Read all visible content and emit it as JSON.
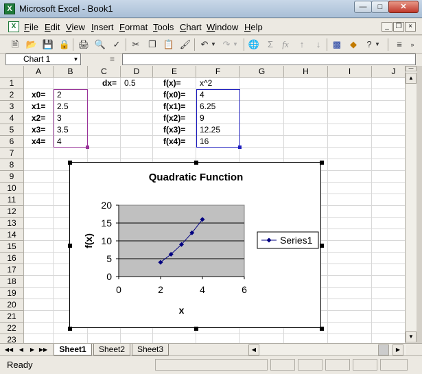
{
  "window": {
    "title": "Microsoft Excel - Book1",
    "app_icon": "X"
  },
  "menu": {
    "doc_icon": "X",
    "items": [
      {
        "label": "File",
        "accel": "F",
        "rest": "ile"
      },
      {
        "label": "Edit",
        "accel": "E",
        "rest": "dit"
      },
      {
        "label": "View",
        "accel": "V",
        "rest": "iew"
      },
      {
        "label": "Insert",
        "accel": "I",
        "rest": "nsert"
      },
      {
        "label": "Format",
        "accel": "F",
        "rest": "ormat",
        "pre": ""
      },
      {
        "label": "Tools",
        "accel": "T",
        "rest": "ools"
      },
      {
        "label": "Chart",
        "accel": "C",
        "rest": "hart"
      },
      {
        "label": "Window",
        "accel": "W",
        "rest": "indow"
      },
      {
        "label": "Help",
        "accel": "H",
        "rest": "elp"
      }
    ]
  },
  "formula_bar": {
    "name_box": "Chart 1",
    "equals": "=",
    "formula": ""
  },
  "columns": [
    "A",
    "B",
    "C",
    "D",
    "E",
    "F",
    "G",
    "H",
    "I",
    "J"
  ],
  "rows": [
    "1",
    "2",
    "3",
    "4",
    "5",
    "6",
    "7",
    "8",
    "9",
    "10",
    "11",
    "12",
    "13",
    "14",
    "15",
    "16",
    "17",
    "18",
    "19",
    "20",
    "21",
    "22",
    "23"
  ],
  "cells": {
    "C1": "dx=",
    "D1": "0.5",
    "E1": "f(x)=",
    "F1": "x^2",
    "A2": "x0=",
    "B2": "2",
    "E2": "f(x0)=",
    "F2": "4",
    "A3": "x1=",
    "B3": "2.5",
    "E3": "f(x1)=",
    "F3": "6.25",
    "A4": "x2=",
    "B4": "3",
    "E4": "f(x2)=",
    "F4": "9",
    "A5": "x3=",
    "B5": "3.5",
    "E5": "f(x3)=",
    "F5": "12.25",
    "A6": "x4=",
    "B6": "4",
    "E6": "f(x4)=",
    "F6": "16"
  },
  "colors": {
    "x_range_border": "#993399",
    "y_range_border": "#1f1fbf",
    "series": "#000080",
    "plot_area": "#c0c0c0"
  },
  "chart_data": {
    "type": "scatter",
    "title": "Quadratic Function",
    "xlabel": "x",
    "ylabel": "f(x)",
    "xlim": [
      0,
      6
    ],
    "ylim": [
      0,
      20
    ],
    "x_ticks": [
      "0",
      "2",
      "4",
      "6"
    ],
    "y_ticks": [
      "0",
      "5",
      "10",
      "15",
      "20"
    ],
    "grid": true,
    "legend_position": "right",
    "series": [
      {
        "name": "Series1",
        "x": [
          2,
          2.5,
          3,
          3.5,
          4
        ],
        "y": [
          4,
          6.25,
          9,
          12.25,
          16
        ]
      }
    ]
  },
  "sheets": [
    {
      "name": "Sheet1",
      "active": true
    },
    {
      "name": "Sheet2",
      "active": false
    },
    {
      "name": "Sheet3",
      "active": false
    }
  ],
  "status": {
    "text": "Ready"
  }
}
